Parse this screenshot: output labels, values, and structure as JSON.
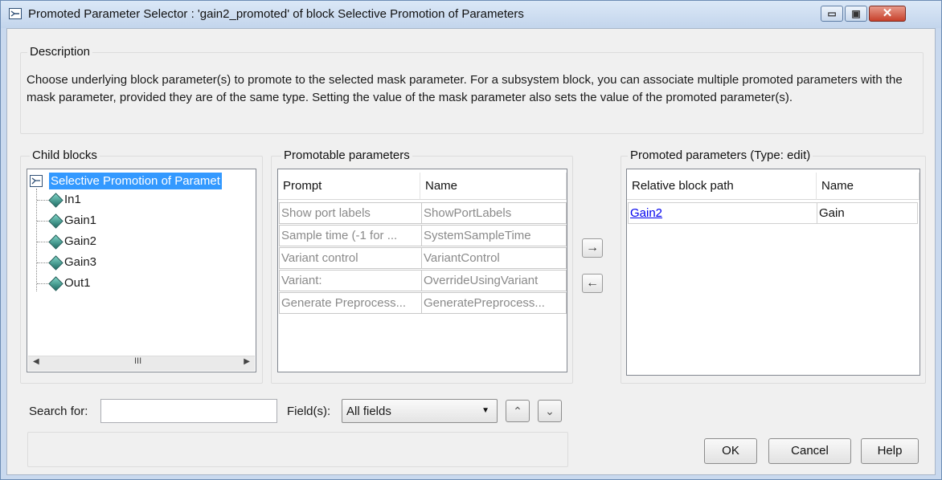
{
  "window": {
    "title": "Promoted Parameter Selector : 'gain2_promoted' of block Selective Promotion of Parameters",
    "min_glyph": "▭",
    "max_glyph": "▣",
    "close_glyph": "✕"
  },
  "description": {
    "label": "Description",
    "text": "Choose underlying block parameter(s) to promote to the selected mask parameter. For a subsystem block, you can associate multiple promoted parameters with the mask parameter, provided they are of the same type. Setting the value of the mask parameter also sets the value of the promoted parameter(s)."
  },
  "child_blocks": {
    "label": "Child blocks",
    "root": "Selective Promotion of Paramet",
    "children": [
      "In1",
      "Gain1",
      "Gain2",
      "Gain3",
      "Out1"
    ],
    "scroll_thumb": "III"
  },
  "promotable": {
    "label": "Promotable parameters",
    "columns": [
      "Prompt",
      "Name"
    ],
    "rows": [
      [
        "Show port labels",
        "ShowPortLabels"
      ],
      [
        "Sample time (-1 for ...",
        "SystemSampleTime"
      ],
      [
        "Variant control",
        "VariantControl"
      ],
      [
        "Variant:",
        "OverrideUsingVariant"
      ],
      [
        "Generate Preprocess...",
        "GeneratePreprocess..."
      ]
    ]
  },
  "transfer": {
    "add": "→",
    "remove": "←"
  },
  "promoted": {
    "label": "Promoted parameters (Type: edit)",
    "columns": [
      "Relative block path",
      "Name"
    ],
    "rows": [
      [
        "Gain2",
        "Gain"
      ]
    ]
  },
  "search": {
    "label": "Search for:",
    "value": "",
    "fields_label": "Field(s):",
    "fields_value": "All fields",
    "up_glyph": "⌃",
    "down_glyph": "⌄"
  },
  "buttons": {
    "ok": "OK",
    "cancel": "Cancel",
    "help": "Help"
  },
  "colors": {
    "selection": "#3399ff",
    "link": "#0000ee",
    "close": "#c7412b"
  }
}
